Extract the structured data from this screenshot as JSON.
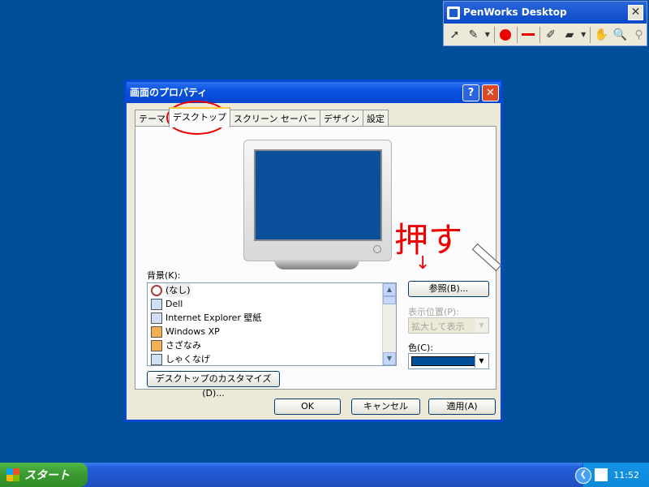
{
  "penworks": {
    "title": "PenWorks Desktop",
    "close_glyph": "✕",
    "tools": [
      "pointer-icon",
      "highlighter-icon",
      "dropdown-icon",
      "red-dot-icon",
      "red-line-icon",
      "pen-icon",
      "eraser-icon",
      "dropdown-icon",
      "hand-icon",
      "zoom-icon",
      "magnifier-icon"
    ]
  },
  "dialog": {
    "title": "画面のプロパティ",
    "help_glyph": "?",
    "close_glyph": "✕",
    "tabs": [
      "テーマ",
      "デスクトップ",
      "スクリーン セーバー",
      "デザイン",
      "設定"
    ],
    "background_label": "背景(K):",
    "backgrounds": [
      "(なし)",
      "Dell",
      "Internet Explorer 壁紙",
      "Windows XP",
      "さざなみ",
      "しゃくなげ"
    ],
    "browse_button": "参照(B)...",
    "position_label": "表示位置(P):",
    "position_value": "拡大して表示",
    "color_label": "色(C):",
    "color_value": "#004e98",
    "customize_button": "デスクトップのカスタマイズ(D)...",
    "ok_button": "OK",
    "cancel_button": "キャンセル",
    "apply_button": "適用(A)"
  },
  "annotations": {
    "handwritten_text": "押す",
    "arrow_glyph": "↓"
  },
  "taskbar": {
    "start_label": "スタート",
    "clock": "11:52"
  }
}
